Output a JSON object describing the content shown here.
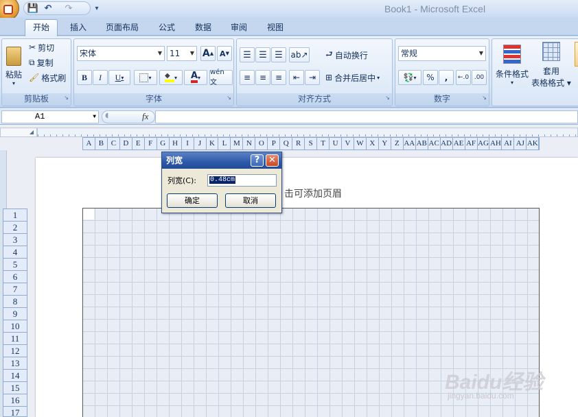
{
  "window": {
    "title": "Book1 - Microsoft Excel"
  },
  "quick_access": {
    "save": "💾",
    "undo": "↶",
    "redo": "↷",
    "customize": "▾"
  },
  "tabs": [
    {
      "label": "开始",
      "active": true
    },
    {
      "label": "插入"
    },
    {
      "label": "页面布局"
    },
    {
      "label": "公式"
    },
    {
      "label": "数据"
    },
    {
      "label": "审阅"
    },
    {
      "label": "视图"
    }
  ],
  "ribbon": {
    "clipboard": {
      "label": "剪贴板",
      "paste": "粘贴",
      "cut": "剪切",
      "copy": "复制",
      "format_painter": "格式刷"
    },
    "font": {
      "label": "字体",
      "font_name": "宋体",
      "font_size": "11",
      "grow": "A",
      "shrink": "A",
      "bold": "B",
      "italic": "I",
      "underline": "U",
      "phonetic": "wén 文"
    },
    "alignment": {
      "label": "对齐方式",
      "wrap": "自动换行",
      "merge": "合并后居中"
    },
    "number": {
      "label": "数字",
      "format": "常规",
      "percent": "%",
      "comma": ","
    },
    "styles": {
      "conditional": "条件格式",
      "table_line1": "套用",
      "table_line2": "表格格式"
    }
  },
  "formula_bar": {
    "name_box": "A1",
    "fx": "fx",
    "formula": ""
  },
  "column_headers": [
    "A",
    "B",
    "C",
    "D",
    "E",
    "F",
    "G",
    "H",
    "I",
    "J",
    "K",
    "L",
    "M",
    "N",
    "O",
    "P",
    "Q",
    "R",
    "S",
    "T",
    "U",
    "V",
    "W",
    "X",
    "Y",
    "Z",
    "AA",
    "AB",
    "AC",
    "AD",
    "AE",
    "AF",
    "AG",
    "AH",
    "AI",
    "AJ",
    "AK"
  ],
  "row_headers": [
    "1",
    "2",
    "3",
    "4",
    "5",
    "6",
    "7",
    "8",
    "9",
    "10",
    "11",
    "12",
    "13",
    "14",
    "15",
    "16",
    "17"
  ],
  "page": {
    "header_hint": "击可添加页眉"
  },
  "dialog": {
    "title": "列宽",
    "help": "?",
    "close": "✕",
    "field_label": "列宽(C):",
    "field_value": "0.48cm",
    "ok": "确定",
    "cancel": "取消"
  },
  "watermark": {
    "text": "Baidu经验",
    "sub": "jingyan.baidu.com"
  }
}
